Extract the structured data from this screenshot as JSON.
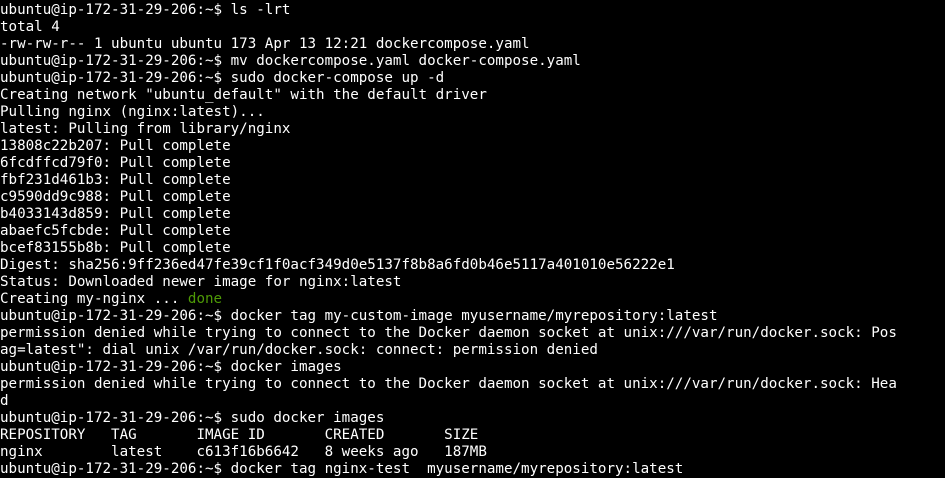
{
  "colors": {
    "background": "#000000",
    "foreground": "#ffffff",
    "done_green": "#4e9a06"
  },
  "lines": [
    "ubuntu@ip-172-31-29-206:~$ ls -lrt",
    "total 4",
    "-rw-rw-r-- 1 ubuntu ubuntu 173 Apr 13 12:21 dockercompose.yaml",
    "ubuntu@ip-172-31-29-206:~$ mv dockercompose.yaml docker-compose.yaml",
    "ubuntu@ip-172-31-29-206:~$ sudo docker-compose up -d",
    "Creating network \"ubuntu_default\" with the default driver",
    "Pulling nginx (nginx:latest)...",
    "latest: Pulling from library/nginx",
    "13808c22b207: Pull complete",
    "6fcdffcd79f0: Pull complete",
    "fbf231d461b3: Pull complete",
    "c9590dd9c988: Pull complete",
    "b4033143d859: Pull complete",
    "abaefc5fcbde: Pull complete",
    "bcef83155b8b: Pull complete",
    "Digest: sha256:9ff236ed47fe39cf1f0acf349d0e5137f8b8a6fd0b46e5117a401010e56222e1",
    "Status: Downloaded newer image for nginx:latest",
    "Creating my-nginx ... ",
    "ubuntu@ip-172-31-29-206:~$ docker tag my-custom-image myusername/myrepository:latest",
    "permission denied while trying to connect to the Docker daemon socket at unix:///var/run/docker.sock: Pos",
    "ag=latest\": dial unix /var/run/docker.sock: connect: permission denied",
    "ubuntu@ip-172-31-29-206:~$ docker images",
    "permission denied while trying to connect to the Docker daemon socket at unix:///var/run/docker.sock: Hea",
    "d",
    "ubuntu@ip-172-31-29-206:~$ sudo docker images",
    "REPOSITORY   TAG       IMAGE ID       CREATED       SIZE",
    "nginx        latest    c613f16b6642   8 weeks ago   187MB",
    "ubuntu@ip-172-31-29-206:~$ docker tag nginx-test  myusername/myrepository:latest"
  ],
  "done_label": "done"
}
